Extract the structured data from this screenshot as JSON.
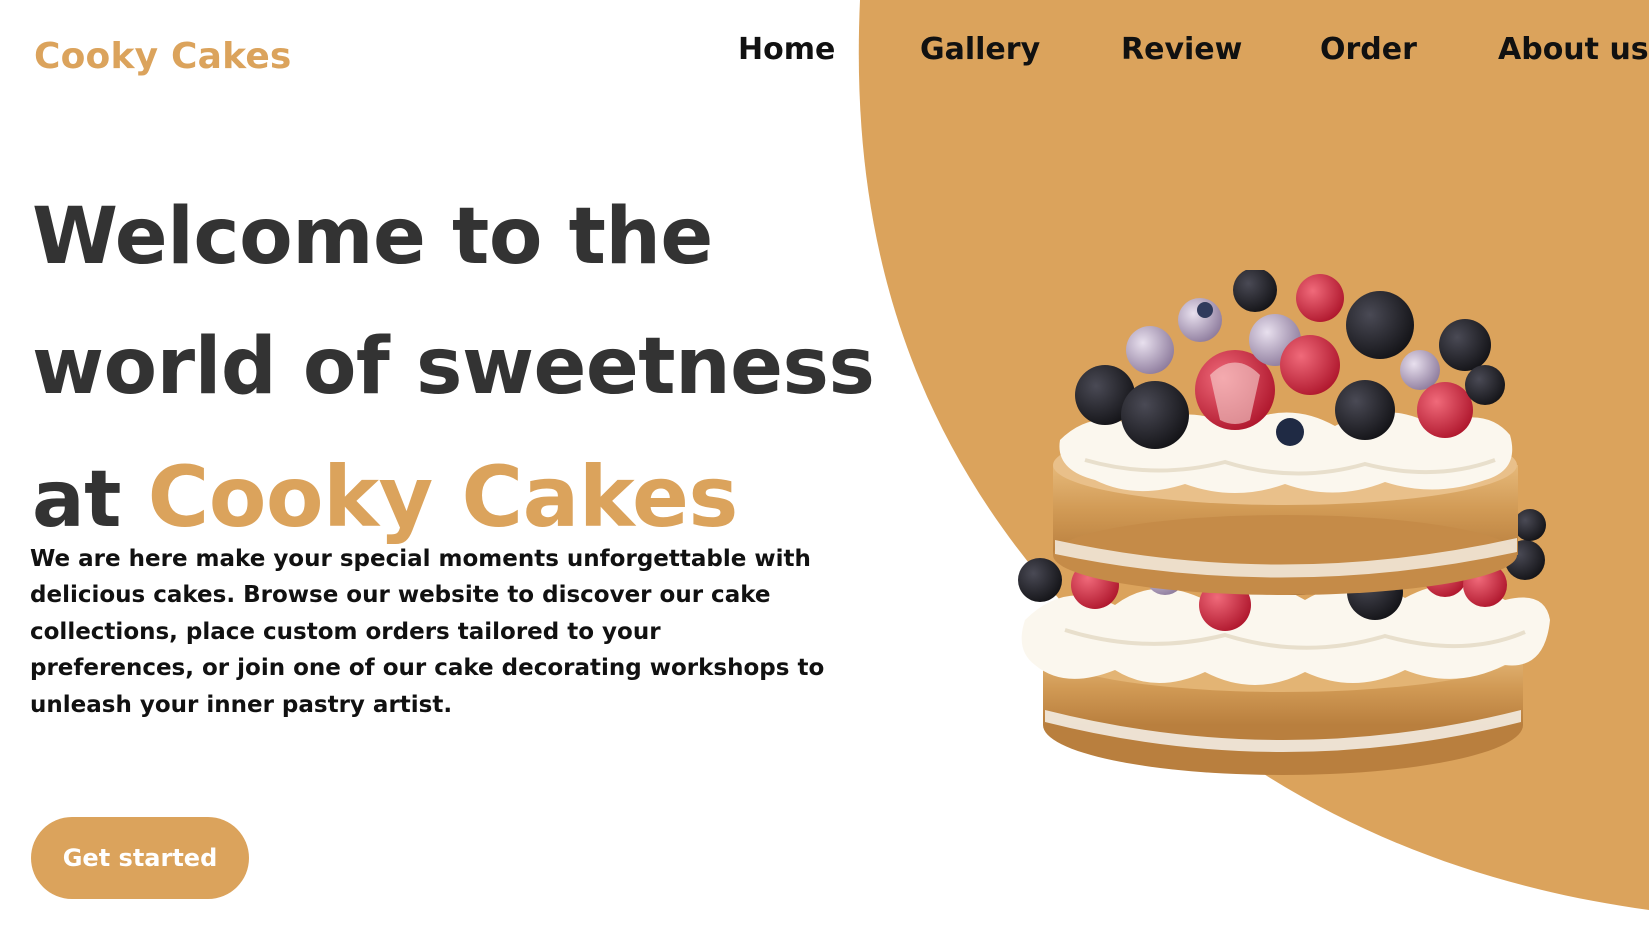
{
  "brand": {
    "name": "Cooky Cakes"
  },
  "nav": {
    "items": [
      {
        "label": "Home"
      },
      {
        "label": "Gallery"
      },
      {
        "label": "Review"
      },
      {
        "label": "Order"
      },
      {
        "label": "About us"
      }
    ]
  },
  "hero": {
    "title_line1": "Welcome to the",
    "title_line2": "world of sweetness",
    "title_line3_prefix": "at ",
    "title_line3_accent": "Cooky Cakes",
    "description": "We are here make your special moments unforgettable with delicious cakes. Browse our website to discover our cake collections, place custom orders tailored to your preferences, or join one of our cake decorating workshops to unleash your inner pastry artist.",
    "cta_label": "Get started",
    "image_icon": "cake-image"
  },
  "colors": {
    "accent": "#DBA35C",
    "heading": "#333333",
    "text": "#111111",
    "background": "#FFFFFF"
  }
}
